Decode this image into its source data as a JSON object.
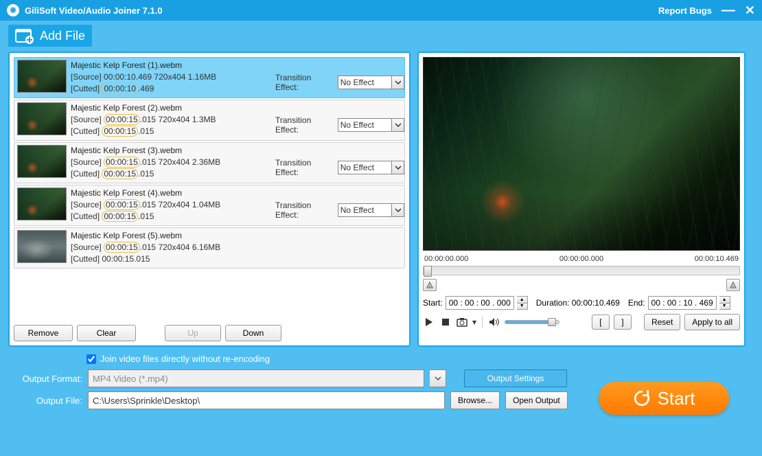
{
  "title": "GiliSoft Video/Audio Joiner 7.1.0",
  "report_bugs": "Report Bugs",
  "add_file": "Add File",
  "files": [
    {
      "name": "Majestic Kelp Forest (1).webm",
      "src": "[Source]  00:00:10.469  720x404  1.16MB",
      "cut": "[Cutted]  ",
      "cut_hl": "00:00:10",
      "cut_tail": ".469",
      "trans": "No Effect",
      "sel": true
    },
    {
      "name": "Majestic Kelp Forest (2).webm",
      "src": "[Source]  ",
      "src_hl": "00:00:15",
      "src_tail": ".015  720x404  1.3MB",
      "cut": "[Cutted]  ",
      "cut_hl": "00:00:15",
      "cut_tail": ".015",
      "trans": "No Effect"
    },
    {
      "name": "Majestic Kelp Forest (3).webm",
      "src": "[Source]  ",
      "src_hl": "00:00:15",
      "src_tail": ".015  720x404  2.36MB",
      "cut": "[Cutted]  ",
      "cut_hl": "00:00:15",
      "cut_tail": ".015",
      "trans": "No Effect"
    },
    {
      "name": "Majestic Kelp Forest (4).webm",
      "src": "[Source]  ",
      "src_hl": "00:00:15",
      "src_tail": ".015  720x404  1.04MB",
      "cut": "[Cutted]  ",
      "cut_hl": "00:00:15",
      "cut_tail": ".015",
      "trans": "No Effect"
    },
    {
      "name": "Majestic Kelp Forest (5).webm",
      "src": "[Source]  ",
      "src_hl": "00:00:15",
      "src_tail": ".015  720x404  6.16MB",
      "cut": "[Cutted]  00:00:15.015",
      "notrans": true
    }
  ],
  "trans_label": "Transition Effect:",
  "btns": {
    "remove": "Remove",
    "clear": "Clear",
    "up": "Up",
    "down": "Down",
    "reset": "Reset",
    "apply": "Apply to all",
    "browse": "Browse...",
    "open": "Open Output",
    "outset": "Output Settings"
  },
  "times": {
    "t0": "00:00:00.000",
    "t1": "00:00:00.000",
    "t2": "00:00:10.469"
  },
  "labels": {
    "start": "Start:",
    "duration": "Duration: 00:00:10.469",
    "end": "End:"
  },
  "startval": "00 : 00 : 00 . 000",
  "endval": "00 : 00 : 10 . 469",
  "check": "Join video files directly without re-encoding",
  "ofmt_label": "Output Format:",
  "ofmt": "MP4 Video (*.mp4)",
  "ofile_label": "Output File:",
  "ofile": "C:\\Users\\Sprinkle\\Desktop\\",
  "start": "Start"
}
